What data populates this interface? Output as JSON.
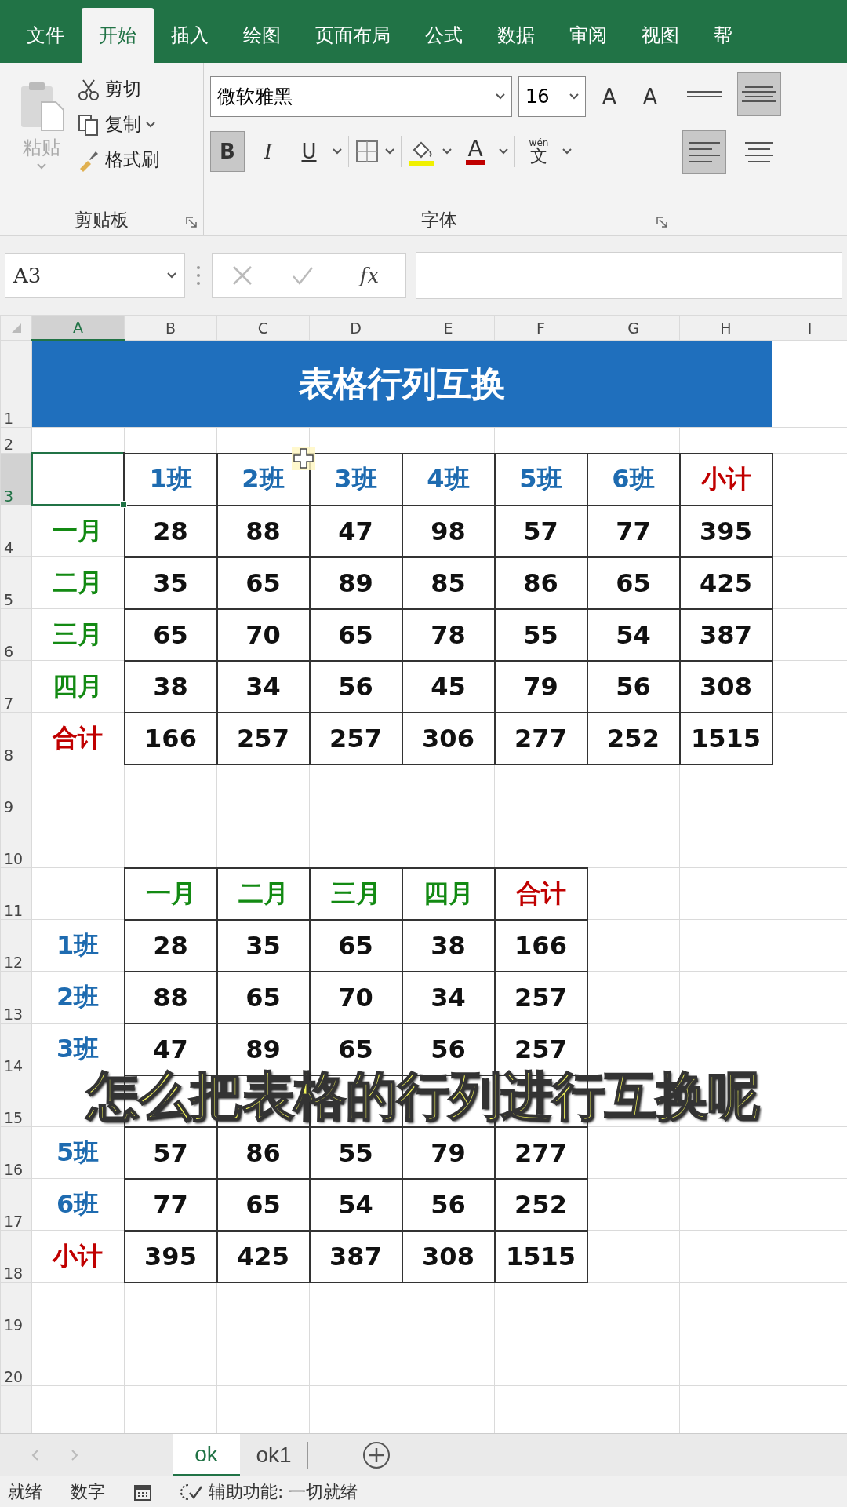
{
  "menu_tabs": [
    {
      "label": "文件",
      "selected": false
    },
    {
      "label": "开始",
      "selected": true
    },
    {
      "label": "插入",
      "selected": false
    },
    {
      "label": "绘图",
      "selected": false
    },
    {
      "label": "页面布局",
      "selected": false
    },
    {
      "label": "公式",
      "selected": false
    },
    {
      "label": "数据",
      "selected": false
    },
    {
      "label": "审阅",
      "selected": false
    },
    {
      "label": "视图",
      "selected": false
    },
    {
      "label": "帮",
      "selected": false
    }
  ],
  "clipboard": {
    "paste": "粘贴",
    "cut": "剪切",
    "copy": "复制",
    "format_painter": "格式刷",
    "group_label": "剪贴板"
  },
  "font": {
    "name": "微软雅黑",
    "size": "16",
    "grow": "A",
    "shrink": "A",
    "bold": {
      "label": "B",
      "selected": true
    },
    "italic": {
      "label": "I",
      "selected": false
    },
    "underline": {
      "label": "U",
      "selected": false
    },
    "font_color": "A",
    "phonetic_top": "wén",
    "phonetic": "文",
    "group_label": "字体"
  },
  "alignment": [
    {
      "kind": "top",
      "selected": false
    },
    {
      "kind": "middle",
      "selected": true
    },
    {
      "kind": "left",
      "selected": true
    },
    {
      "kind": "center",
      "selected": false
    }
  ],
  "formula_bar": {
    "name_box": "A3",
    "function_label": "fx"
  },
  "columns": [
    "A",
    "B",
    "C",
    "D",
    "E",
    "F",
    "G",
    "H",
    "I"
  ],
  "rows": [
    {
      "number": "1",
      "kind": "title",
      "title": "表格行列互换"
    },
    {
      "number": "2",
      "kind": "short"
    },
    {
      "number": "3",
      "kind": "normal",
      "cells": [
        {
          "kind": "selected"
        },
        {
          "kind": "header",
          "text": "1班",
          "color": "#1e6bb0"
        },
        {
          "kind": "header",
          "text": "2班",
          "color": "#1e6bb0"
        },
        {
          "kind": "header",
          "text": "3班",
          "color": "#1e6bb0"
        },
        {
          "kind": "header",
          "text": "4班",
          "color": "#1e6bb0"
        },
        {
          "kind": "header",
          "text": "5班",
          "color": "#1e6bb0"
        },
        {
          "kind": "header",
          "text": "6班",
          "color": "#1e6bb0"
        },
        {
          "kind": "header",
          "text": "小计",
          "color": "#c00000"
        }
      ]
    },
    {
      "number": "4",
      "kind": "normal",
      "cells": [
        {
          "kind": "label",
          "text": "一月",
          "color": "#138a13"
        },
        {
          "kind": "value",
          "text": "28",
          "color": "#111111"
        },
        {
          "kind": "value",
          "text": "88",
          "color": "#111111"
        },
        {
          "kind": "value",
          "text": "47",
          "color": "#111111"
        },
        {
          "kind": "value",
          "text": "98",
          "color": "#111111"
        },
        {
          "kind": "value",
          "text": "57",
          "color": "#111111"
        },
        {
          "kind": "value",
          "text": "77",
          "color": "#111111"
        },
        {
          "kind": "value",
          "text": "395",
          "color": "#111111"
        }
      ]
    },
    {
      "number": "5",
      "kind": "normal",
      "cells": [
        {
          "kind": "label",
          "text": "二月",
          "color": "#138a13"
        },
        {
          "kind": "value",
          "text": "35",
          "color": "#111111"
        },
        {
          "kind": "value",
          "text": "65",
          "color": "#111111"
        },
        {
          "kind": "value",
          "text": "89",
          "color": "#111111"
        },
        {
          "kind": "value",
          "text": "85",
          "color": "#111111"
        },
        {
          "kind": "value",
          "text": "86",
          "color": "#111111"
        },
        {
          "kind": "value",
          "text": "65",
          "color": "#111111"
        },
        {
          "kind": "value",
          "text": "425",
          "color": "#111111"
        }
      ]
    },
    {
      "number": "6",
      "kind": "normal",
      "cells": [
        {
          "kind": "label",
          "text": "三月",
          "color": "#138a13"
        },
        {
          "kind": "value",
          "text": "65",
          "color": "#111111"
        },
        {
          "kind": "value",
          "text": "70",
          "color": "#111111"
        },
        {
          "kind": "value",
          "text": "65",
          "color": "#111111"
        },
        {
          "kind": "value",
          "text": "78",
          "color": "#111111"
        },
        {
          "kind": "value",
          "text": "55",
          "color": "#111111"
        },
        {
          "kind": "value",
          "text": "54",
          "color": "#111111"
        },
        {
          "kind": "value",
          "text": "387",
          "color": "#111111"
        }
      ]
    },
    {
      "number": "7",
      "kind": "normal",
      "cells": [
        {
          "kind": "label",
          "text": "四月",
          "color": "#138a13"
        },
        {
          "kind": "value",
          "text": "38",
          "color": "#111111"
        },
        {
          "kind": "value",
          "text": "34",
          "color": "#111111"
        },
        {
          "kind": "value",
          "text": "56",
          "color": "#111111"
        },
        {
          "kind": "value",
          "text": "45",
          "color": "#111111"
        },
        {
          "kind": "value",
          "text": "79",
          "color": "#111111"
        },
        {
          "kind": "value",
          "text": "56",
          "color": "#111111"
        },
        {
          "kind": "value",
          "text": "308",
          "color": "#111111"
        }
      ]
    },
    {
      "number": "8",
      "kind": "normal",
      "cells": [
        {
          "kind": "label",
          "text": "合计",
          "color": "#c00000"
        },
        {
          "kind": "value",
          "text": "166",
          "color": "#111111"
        },
        {
          "kind": "value",
          "text": "257",
          "color": "#111111"
        },
        {
          "kind": "value",
          "text": "257",
          "color": "#111111"
        },
        {
          "kind": "value",
          "text": "306",
          "color": "#111111"
        },
        {
          "kind": "value",
          "text": "277",
          "color": "#111111"
        },
        {
          "kind": "value",
          "text": "252",
          "color": "#111111"
        },
        {
          "kind": "value",
          "text": "1515",
          "color": "#111111"
        }
      ]
    },
    {
      "number": "9",
      "kind": "normal"
    },
    {
      "number": "10",
      "kind": "normal"
    },
    {
      "number": "11",
      "kind": "normal",
      "cells": [
        {
          "kind": "empty"
        },
        {
          "kind": "header",
          "text": "一月",
          "color": "#138a13"
        },
        {
          "kind": "header",
          "text": "二月",
          "color": "#138a13"
        },
        {
          "kind": "header",
          "text": "三月",
          "color": "#138a13"
        },
        {
          "kind": "header",
          "text": "四月",
          "color": "#138a13"
        },
        {
          "kind": "header",
          "text": "合计",
          "color": "#c00000"
        }
      ]
    },
    {
      "number": "12",
      "kind": "normal",
      "cells": [
        {
          "kind": "label",
          "text": "1班",
          "color": "#1e6bb0"
        },
        {
          "kind": "value",
          "text": "28",
          "color": "#111111"
        },
        {
          "kind": "value",
          "text": "35",
          "color": "#111111"
        },
        {
          "kind": "value",
          "text": "65",
          "color": "#111111"
        },
        {
          "kind": "value",
          "text": "38",
          "color": "#111111"
        },
        {
          "kind": "value",
          "text": "166",
          "color": "#111111"
        }
      ]
    },
    {
      "number": "13",
      "kind": "normal",
      "cells": [
        {
          "kind": "label",
          "text": "2班",
          "color": "#1e6bb0"
        },
        {
          "kind": "value",
          "text": "88",
          "color": "#111111"
        },
        {
          "kind": "value",
          "text": "65",
          "color": "#111111"
        },
        {
          "kind": "value",
          "text": "70",
          "color": "#111111"
        },
        {
          "kind": "value",
          "text": "34",
          "color": "#111111"
        },
        {
          "kind": "value",
          "text": "257",
          "color": "#111111"
        }
      ]
    },
    {
      "number": "14",
      "kind": "normal",
      "cells": [
        {
          "kind": "label",
          "text": "3班",
          "color": "#1e6bb0"
        },
        {
          "kind": "value",
          "text": "47",
          "color": "#111111"
        },
        {
          "kind": "value",
          "text": "89",
          "color": "#111111"
        },
        {
          "kind": "value",
          "text": "65",
          "color": "#111111"
        },
        {
          "kind": "value",
          "text": "56",
          "color": "#111111"
        },
        {
          "kind": "value",
          "text": "257",
          "color": "#111111"
        }
      ]
    },
    {
      "number": "15",
      "kind": "normal",
      "cells": [
        {
          "kind": "empty"
        },
        {
          "kind": "value"
        },
        {
          "kind": "value"
        },
        {
          "kind": "value"
        },
        {
          "kind": "value"
        },
        {
          "kind": "value"
        }
      ]
    },
    {
      "number": "16",
      "kind": "normal",
      "cells": [
        {
          "kind": "label",
          "text": "5班",
          "color": "#1e6bb0"
        },
        {
          "kind": "value",
          "text": "57",
          "color": "#111111"
        },
        {
          "kind": "value",
          "text": "86",
          "color": "#111111"
        },
        {
          "kind": "value",
          "text": "55",
          "color": "#111111"
        },
        {
          "kind": "value",
          "text": "79",
          "color": "#111111"
        },
        {
          "kind": "value",
          "text": "277",
          "color": "#111111"
        }
      ]
    },
    {
      "number": "17",
      "kind": "normal",
      "cells": [
        {
          "kind": "label",
          "text": "6班",
          "color": "#1e6bb0"
        },
        {
          "kind": "value",
          "text": "77",
          "color": "#111111"
        },
        {
          "kind": "value",
          "text": "65",
          "color": "#111111"
        },
        {
          "kind": "value",
          "text": "54",
          "color": "#111111"
        },
        {
          "kind": "value",
          "text": "56",
          "color": "#111111"
        },
        {
          "kind": "value",
          "text": "252",
          "color": "#111111"
        }
      ]
    },
    {
      "number": "18",
      "kind": "normal",
      "cells": [
        {
          "kind": "label",
          "text": "小计",
          "color": "#c00000"
        },
        {
          "kind": "value",
          "text": "395",
          "color": "#111111"
        },
        {
          "kind": "value",
          "text": "425",
          "color": "#111111"
        },
        {
          "kind": "value",
          "text": "387",
          "color": "#111111"
        },
        {
          "kind": "value",
          "text": "308",
          "color": "#111111"
        },
        {
          "kind": "value",
          "text": "1515",
          "color": "#111111"
        }
      ]
    },
    {
      "number": "19",
      "kind": "normal"
    },
    {
      "number": "20",
      "kind": "normal"
    }
  ],
  "subtitle": "怎么把表格的行列进行互换呢",
  "sheet_tabs": [
    {
      "label": "ok",
      "selected": true
    },
    {
      "label": "ok1",
      "selected": false
    }
  ],
  "status_bar": {
    "ready": "就绪",
    "mode": "数字",
    "accessibility": "辅助功能: 一切就绪"
  }
}
